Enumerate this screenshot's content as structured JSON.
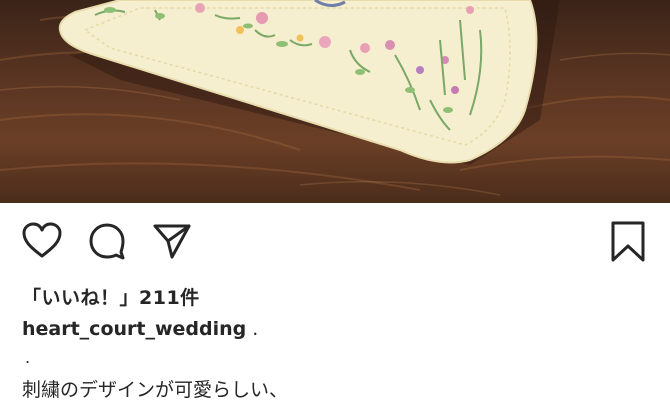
{
  "post": {
    "image_icon": "photo-ring-pillow",
    "likes_text": "「いいね！」211件",
    "username": "heart_court_wedding",
    "username_suffix": " .",
    "caption_dot": ".",
    "caption_line": "刺繍のデザインが可愛らしい、"
  },
  "actions": {
    "like_icon": "heart-outline-icon",
    "comment_icon": "speech-bubble-icon",
    "share_icon": "paper-plane-icon",
    "save_icon": "bookmark-icon"
  },
  "colors": {
    "text": "#262626",
    "background": "#ffffff"
  }
}
